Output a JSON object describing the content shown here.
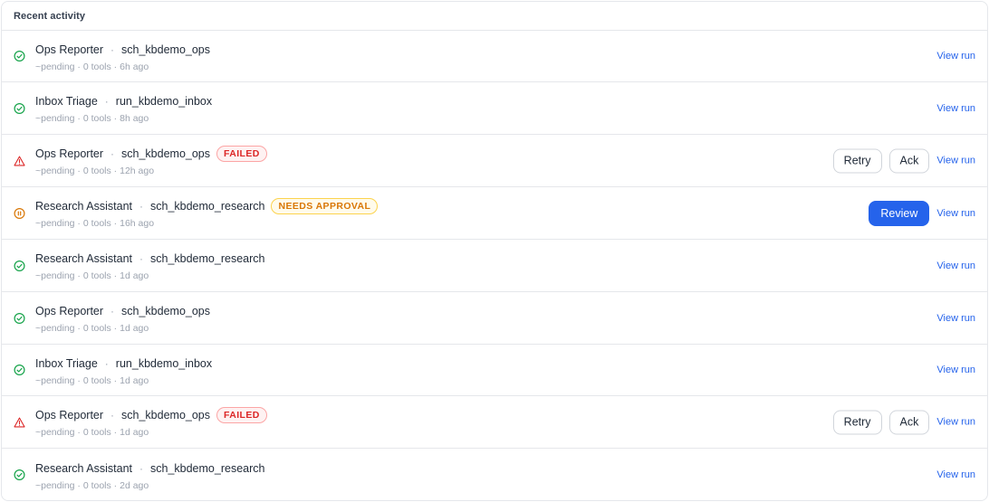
{
  "panel": {
    "title": "Recent activity"
  },
  "colors": {
    "success": "#16a34a",
    "failed": "#dc2626",
    "approval": "#d97706",
    "accent": "#2563eb"
  },
  "rows": [
    {
      "status": "success",
      "status_icon": "check-circle-icon",
      "agent": "Ops Reporter",
      "schedule": "sch_kbdemo_ops",
      "badge": "",
      "meta": "~pending · 0 tools · 6h ago",
      "actions": [],
      "link": "View run"
    },
    {
      "status": "success",
      "status_icon": "check-circle-icon",
      "agent": "Inbox Triage",
      "schedule": "run_kbdemo_inbox",
      "badge": "",
      "meta": "~pending · 0 tools · 8h ago",
      "actions": [],
      "link": "View run"
    },
    {
      "status": "failed",
      "status_icon": "warning-triangle-icon",
      "agent": "Ops Reporter",
      "schedule": "sch_kbdemo_ops",
      "badge": "FAILED",
      "meta": "~pending · 0 tools · 12h ago",
      "actions": [
        "Retry",
        "Ack"
      ],
      "link": "View run"
    },
    {
      "status": "approval",
      "status_icon": "pause-circle-icon",
      "agent": "Research Assistant",
      "schedule": "sch_kbdemo_research",
      "badge": "NEEDS APPROVAL",
      "meta": "~pending · 0 tools · 16h ago",
      "actions": [
        "Review"
      ],
      "link": "View run"
    },
    {
      "status": "success",
      "status_icon": "check-circle-icon",
      "agent": "Research Assistant",
      "schedule": "sch_kbdemo_research",
      "badge": "",
      "meta": "~pending · 0 tools · 1d ago",
      "actions": [],
      "link": "View run"
    },
    {
      "status": "success",
      "status_icon": "check-circle-icon",
      "agent": "Ops Reporter",
      "schedule": "sch_kbdemo_ops",
      "badge": "",
      "meta": "~pending · 0 tools · 1d ago",
      "actions": [],
      "link": "View run"
    },
    {
      "status": "success",
      "status_icon": "check-circle-icon",
      "agent": "Inbox Triage",
      "schedule": "run_kbdemo_inbox",
      "badge": "",
      "meta": "~pending · 0 tools · 1d ago",
      "actions": [],
      "link": "View run"
    },
    {
      "status": "failed",
      "status_icon": "warning-triangle-icon",
      "agent": "Ops Reporter",
      "schedule": "sch_kbdemo_ops",
      "badge": "FAILED",
      "meta": "~pending · 0 tools · 1d ago",
      "actions": [
        "Retry",
        "Ack"
      ],
      "link": "View run"
    },
    {
      "status": "success",
      "status_icon": "check-circle-icon",
      "agent": "Research Assistant",
      "schedule": "sch_kbdemo_research",
      "badge": "",
      "meta": "~pending · 0 tools · 2d ago",
      "actions": [],
      "link": "View run"
    }
  ]
}
